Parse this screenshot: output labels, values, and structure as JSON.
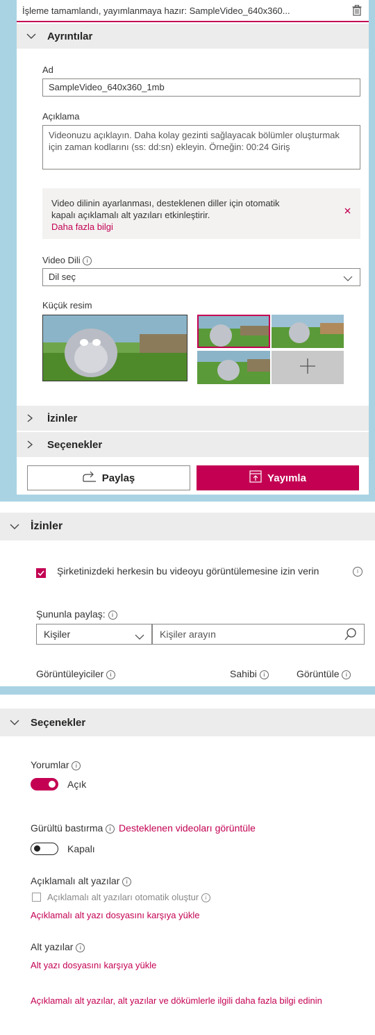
{
  "colors": {
    "accent": "#c30052",
    "background": "#a9d3e3"
  },
  "topbar": {
    "status_text": "İşleme tamamlandı, yayımlanmaya hazır: SampleVideo_640x360..."
  },
  "details": {
    "header": "Ayrıntılar",
    "name_label": "Ad",
    "name_value": "SampleVideo_640x360_1mb",
    "desc_label": "Açıklama",
    "desc_placeholder": "Videonuzu açıklayın. Daha kolay gezinti sağlayacak bölümler oluşturmak için zaman kodlarını (ss: dd:sn) ekleyin. Örneğin: 00:24 Giriş",
    "info_text": "Video dilinin ayarlanması, desteklenen diller için otomatik kapalı açıklamalı alt yazıları etkinleştirir.",
    "info_link": "Daha fazla bilgi",
    "lang_label": "Video Dili",
    "lang_value": "Dil seç",
    "thumb_label": "Küçük resim"
  },
  "collapsed": {
    "permissions": "İzinler",
    "options": "Seçenekler"
  },
  "actions": {
    "share": "Paylaş",
    "publish": "Yayımla"
  },
  "permissions": {
    "header": "İzinler",
    "checkbox_label": "Şirketinizdeki herkesin bu videoyu görüntülemesine izin verin",
    "checkbox_checked": true,
    "share_with_label": "Şununla paylaş:",
    "share_type": "Kişiler",
    "search_placeholder": "Kişiler arayın",
    "viewers_label": "Görüntüleyiciler",
    "owner_label": "Sahibi",
    "view_label": "Görüntüle"
  },
  "options": {
    "header": "Seçenekler",
    "comments_label": "Yorumlar",
    "comments_state": "Açık",
    "noise_label": "Gürültü bastırma",
    "noise_link": "Desteklenen videoları görüntüle",
    "noise_state": "Kapalı",
    "cc_label": "Açıklamalı alt yazılar",
    "cc_auto_label": "Açıklamalı alt yazıları otomatik oluştur",
    "cc_upload": "Açıklamalı alt yazı dosyasını karşıya yükle",
    "subs_label": "Alt yazılar",
    "subs_upload": "Alt yazı dosyasını karşıya yükle",
    "learn_more": "Açıklamalı alt yazılar, alt yazılar ve dökümlerle ilgili daha fazla bilgi edinin"
  }
}
